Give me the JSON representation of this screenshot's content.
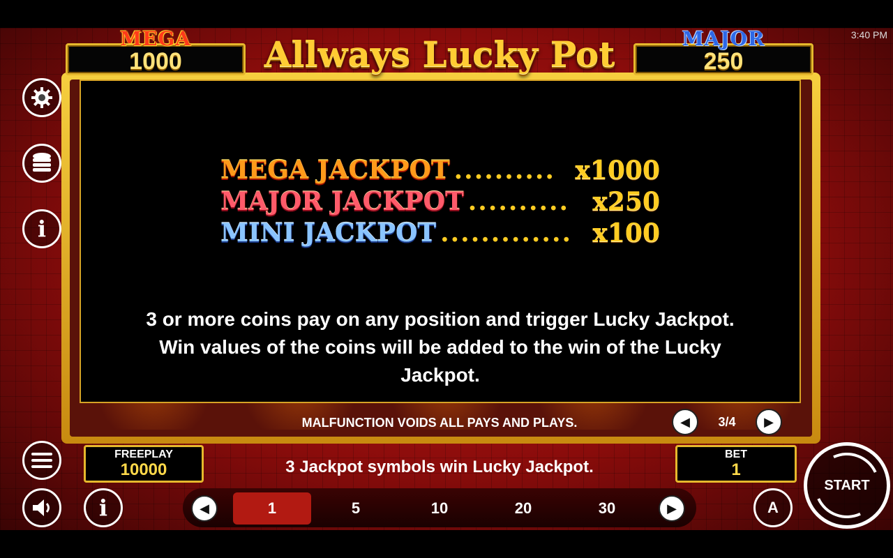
{
  "status": {
    "time": "3:40 PM"
  },
  "header": {
    "title": "Allways Lucky Pot",
    "mega": {
      "label": "MEGA",
      "value": "1000"
    },
    "major": {
      "label": "MAJOR",
      "value": "250"
    }
  },
  "paytable": {
    "rows": [
      {
        "name": "MEGA JACKPOT",
        "dots": "..........",
        "multiplier": "x1000"
      },
      {
        "name": "MAJOR JACKPOT",
        "dots": "..........",
        "multiplier": "x250"
      },
      {
        "name": "MINI JACKPOT",
        "dots": ".............",
        "multiplier": "x100"
      }
    ],
    "description_line1": "3 or more coins pay on any position and trigger Lucky Jackpot.",
    "description_line2": "Win values of the coins will be added to the win of the Lucky",
    "description_line3": "Jackpot.",
    "malfunction": "MALFUNCTION VOIDS ALL PAYS AND PLAYS.",
    "page": "3/4"
  },
  "sidebar": {
    "icons": [
      "gear-icon",
      "coins-icon",
      "info-icon",
      "menu-icon",
      "sound-icon"
    ]
  },
  "footer": {
    "freeplay": {
      "label": "FREEPLAY",
      "value": "10000"
    },
    "message": "3 Jackpot symbols win Lucky Jackpot.",
    "bet": {
      "label": "BET",
      "value": "1"
    },
    "bet_options": [
      "1",
      "5",
      "10",
      "20",
      "30"
    ],
    "selected_bet": "1",
    "start_label": "START",
    "auto_label": "A"
  }
}
